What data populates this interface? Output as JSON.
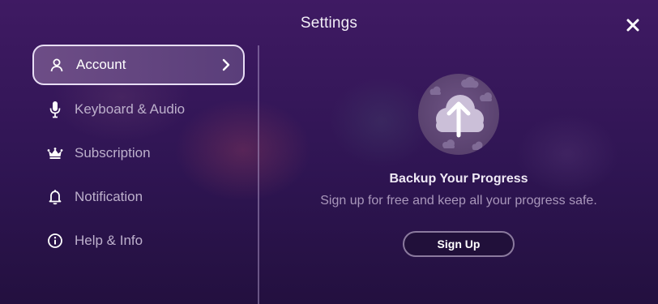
{
  "header": {
    "title": "Settings"
  },
  "sidebar": {
    "items": [
      {
        "label": "Account",
        "icon": "user-icon",
        "active": true
      },
      {
        "label": "Keyboard & Audio",
        "icon": "microphone-icon"
      },
      {
        "label": "Subscription",
        "icon": "crown-icon"
      },
      {
        "label": "Notification",
        "icon": "bell-icon"
      },
      {
        "label": "Help & Info",
        "icon": "info-icon"
      }
    ]
  },
  "main": {
    "badge_icon": "cloud-upload-icon",
    "title": "Backup Your Progress",
    "subtitle": "Sign up for free and keep all your progress safe.",
    "button_label": "Sign Up"
  },
  "colors": {
    "background": "#331758",
    "active_item": "#664886",
    "text_muted": "#bdb0cc"
  }
}
